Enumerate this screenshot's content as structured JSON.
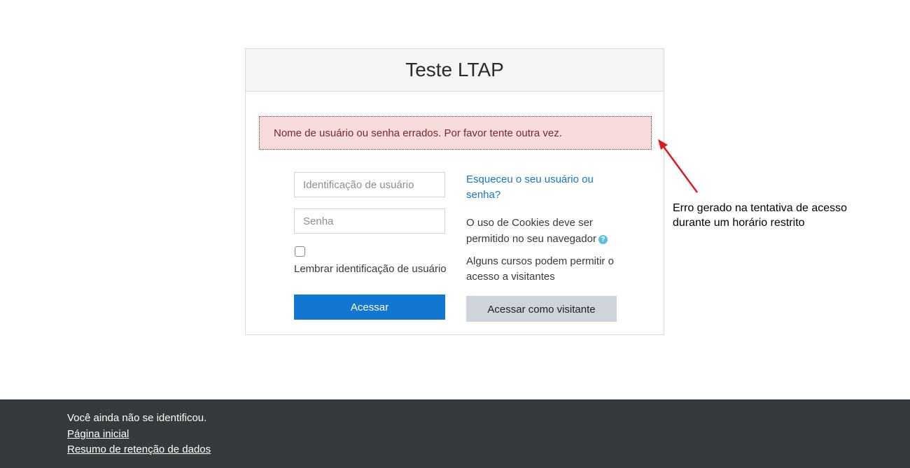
{
  "login": {
    "title": "Teste LTAP",
    "error_message": "Nome de usuário ou senha errados. Por favor tente outra vez.",
    "username_placeholder": "Identificação de usuário",
    "password_placeholder": "Senha",
    "remember_label": "Lembrar identificação de usuário",
    "remember_checked": false,
    "login_button": "Acessar",
    "forgot_link": "Esqueceu o seu usuário ou senha?",
    "cookies_notice": "O uso de Cookies deve ser permitido no seu navegador",
    "cookies_help_icon": "question-circle-icon",
    "guest_notice": "Alguns cursos podem permitir o acesso a visitantes",
    "guest_button": "Acessar como visitante"
  },
  "annotation": {
    "text": "Erro gerado na tentativa de acesso durante um horário restrito",
    "arrow_color": "#e0191b"
  },
  "footer": {
    "status": "Você ainda não se identificou.",
    "home_link": "Página inicial",
    "retention_link": "Resumo de retenção de dados"
  },
  "colors": {
    "primary": "#1177d1",
    "alert_bg": "#f8dcdd",
    "alert_text": "#7d2425",
    "footer_bg": "#373a3c",
    "secondary_button": "#ced4da"
  }
}
